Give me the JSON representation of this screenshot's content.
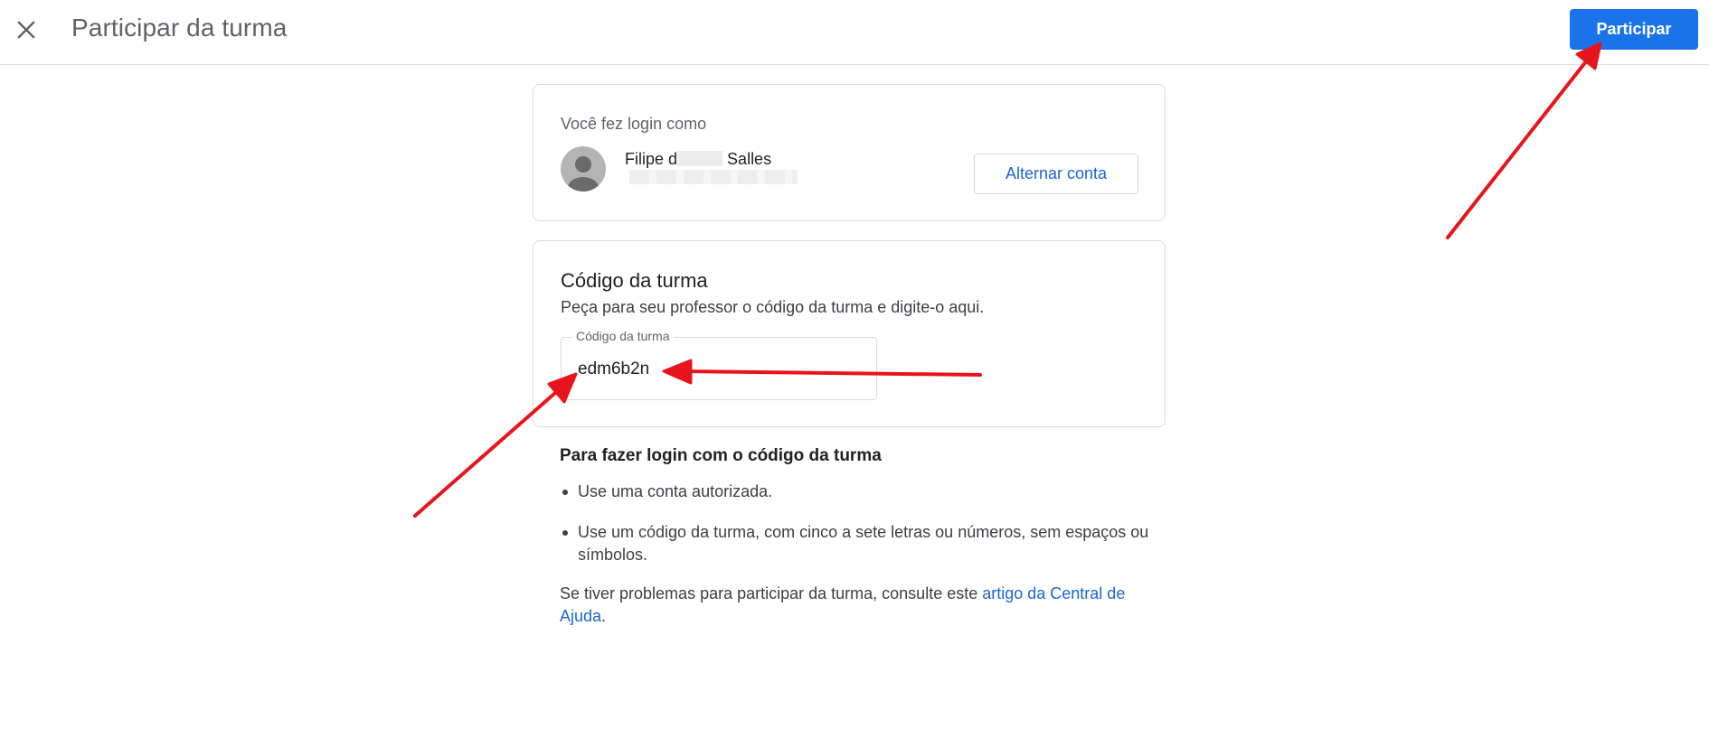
{
  "header": {
    "title": "Participar da turma",
    "join_label": "Participar"
  },
  "account": {
    "label": "Você fez login como",
    "name_first": "Filipe d",
    "name_last": "Salles",
    "switch_label": "Alternar conta"
  },
  "class_code": {
    "title": "Código da turma",
    "subtitle": "Peça para seu professor o código da turma e digite-o aqui.",
    "field_label": "Código da turma",
    "value": "edm6b2n"
  },
  "instructions": {
    "title": "Para fazer login com o código da turma",
    "items": [
      "Use uma conta autorizada.",
      "Use um código da turma, com cinco a sete letras ou números, sem espaços ou símbolos."
    ],
    "help_prefix": "Se tiver problemas para participar da turma, consulte este ",
    "help_link": "artigo da Central de Ajuda",
    "help_suffix": "."
  },
  "icons": {
    "close": "close-icon",
    "avatar": "account-avatar-icon",
    "annotation": "red-arrow"
  },
  "colors": {
    "primary": "#1a73e8",
    "link": "#1967d2",
    "annotation": "#e8141c"
  }
}
